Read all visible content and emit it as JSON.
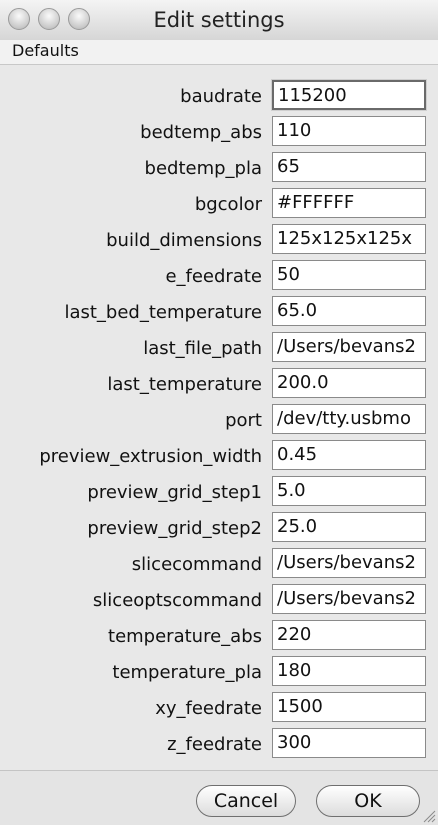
{
  "window": {
    "title": "Edit settings"
  },
  "menubar": {
    "defaults_label": "Defaults"
  },
  "settings": [
    {
      "key": "baudrate",
      "value": "115200"
    },
    {
      "key": "bedtemp_abs",
      "value": "110"
    },
    {
      "key": "bedtemp_pla",
      "value": "65"
    },
    {
      "key": "bgcolor",
      "value": "#FFFFFF"
    },
    {
      "key": "build_dimensions",
      "value": "125x125x125x"
    },
    {
      "key": "e_feedrate",
      "value": "50"
    },
    {
      "key": "last_bed_temperature",
      "value": "65.0"
    },
    {
      "key": "last_file_path",
      "value": "/Users/bevans2"
    },
    {
      "key": "last_temperature",
      "value": "200.0"
    },
    {
      "key": "port",
      "value": "/dev/tty.usbmo"
    },
    {
      "key": "preview_extrusion_width",
      "value": "0.45"
    },
    {
      "key": "preview_grid_step1",
      "value": "5.0"
    },
    {
      "key": "preview_grid_step2",
      "value": "25.0"
    },
    {
      "key": "slicecommand",
      "value": "/Users/bevans2"
    },
    {
      "key": "sliceoptscommand",
      "value": "/Users/bevans2"
    },
    {
      "key": "temperature_abs",
      "value": "220"
    },
    {
      "key": "temperature_pla",
      "value": "180"
    },
    {
      "key": "xy_feedrate",
      "value": "1500"
    },
    {
      "key": "z_feedrate",
      "value": "300"
    }
  ],
  "buttons": {
    "cancel_label": "Cancel",
    "ok_label": "OK"
  }
}
